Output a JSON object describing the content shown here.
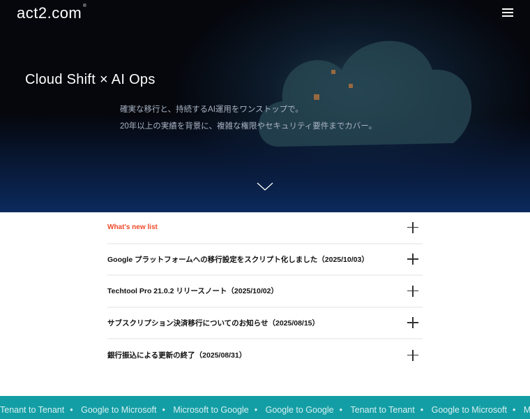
{
  "header": {
    "logo": "act2.com",
    "logo_mark": "®"
  },
  "hero": {
    "title": "Cloud Shift × AI Ops",
    "lines": [
      "確実な移行と、持続するAI運用をワンストップで。",
      "20年以上の実績を背景に、複雑な権限やセキュリティ要件までカバー。"
    ]
  },
  "news": {
    "heading": "What's new list",
    "items": [
      "Google プラットフォームへの移行設定をスクリプト化しました（2025/10/03）",
      "Techtool Pro 21.0.2 リリースノート（2025/10/02）",
      "サブスクリプション決済移行についてのお知らせ（2025/08/15）",
      "銀行振込による更新の終了（2025/08/31）"
    ]
  },
  "ticker": {
    "items": [
      "Tenant to Tenant",
      "Google to Microsoft",
      "Microsoft to Google",
      "Google to Google",
      "Tenant to Tenant",
      "Google to Microsoft",
      "Microsoft to Google"
    ],
    "separator": "•"
  },
  "colors": {
    "accent": "#f04a2a",
    "ticker_bg": "#139ea5"
  }
}
